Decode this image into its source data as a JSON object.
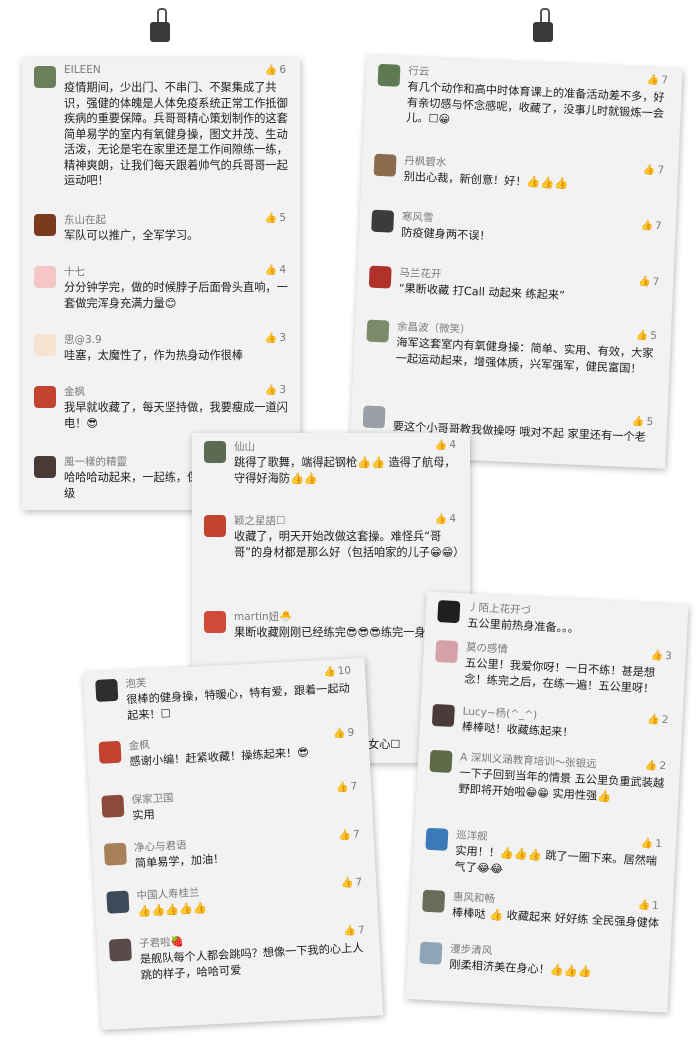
{
  "cards": [
    {
      "comments": [
        {
          "name": "EILEEN",
          "likes": "6",
          "text": "疫情期间，少出门、不串门、不聚集成了共识，强健的体魄是人体免疫系统正常工作抵御疾病的重要保障。兵哥哥精心策划制作的这套简单易学的室内有氧健身操，图文并茂、生动活泼，无论是宅在家里还是工作间隙练一练，精神爽朗，让我们每天跟着帅气的兵哥哥一起运动吧！",
          "color": "#6b7f5a"
        },
        {
          "name": "东山在起",
          "likes": "5",
          "text": "军队可以推广，全军学习。",
          "color": "#7a3a1e"
        },
        {
          "name": "十七",
          "likes": "4",
          "text": "分分钟学完，做的时候脖子后面骨头直响，一套做完浑身充满力量😊",
          "color": "#f4c6c6"
        },
        {
          "name": "思@3.9",
          "likes": "3",
          "text": "哇塞，太魔性了，作为热身动作很棒",
          "color": "#f7e3d2"
        },
        {
          "name": "金枫",
          "likes": "3",
          "text": "我早就收藏了，每天坚持做，我要瘦成一道闪电！😎",
          "color": "#c2442f"
        },
        {
          "name": "風一樣的精靈",
          "likes": "",
          "text": "哈哈哈动起来，一起练，保家卫国！封面图超级",
          "color": "#4a3a36"
        }
      ]
    },
    {
      "comments": [
        {
          "name": "行云",
          "likes": "7",
          "text": "有几个动作和高中时体育课上的准备活动差不多，好有亲切感与怀念感呢，收藏了，没事儿时就锻炼一会儿。☐😀",
          "color": "#5e7a52"
        },
        {
          "name": "丹枫碧水",
          "likes": "7",
          "text": "别出心裁，新创意！好！👍👍👍",
          "color": "#8b6a4e"
        },
        {
          "name": "寒风雪",
          "likes": "7",
          "text": "防疫健身两不误！",
          "color": "#3b3b3b"
        },
        {
          "name": "马兰花开",
          "likes": "7",
          "text": "“果断收藏 打Call 动起来 练起来”",
          "color": "#b0322a"
        },
        {
          "name": "余昌波（微笑）",
          "likes": "5",
          "text": "海军这套室内有氧健身操：简单、实用、有效，大家一起运动起来，增强体质，兴军强军，健民富国！",
          "color": "#7d8a6a"
        },
        {
          "name": "",
          "likes": "5",
          "text": "要这个小哥哥教我做操呀 哦对不起 家里还有一个老哥哥",
          "color": "#9aa0a6"
        }
      ]
    },
    {
      "comments": [
        {
          "name": "仙山",
          "likes": "4",
          "text": "跳得了歌舞，端得起钢枪👍👍 造得了航母，守得好海防👍👍",
          "color": "#5b6b52"
        },
        {
          "name": "颖之星語☐",
          "likes": "4",
          "text": "收藏了，明天开始改做这套操。难怪兵“哥哥”的身材都是那么好（包括咱家的儿子😁😁）",
          "color": "#c2442f"
        },
        {
          "name": "martin妞🐣",
          "likes": "4",
          "text": "果断收藏刚刚已经练完😎😎😎练完一身轻",
          "color": "#d04a3a"
        },
        {
          "name": "",
          "likes": "",
          "text": "女心☐",
          "color": "#d6d6d6"
        }
      ]
    },
    {
      "comments": [
        {
          "name": "泡芙",
          "likes": "10",
          "text": "很棒的健身操，特暖心，特有爱，跟着一起动起来！☐",
          "color": "#2d2d2d"
        },
        {
          "name": "金枫",
          "likes": "9",
          "text": "感谢小编！赶紧收藏！操练起来！😎",
          "color": "#c2442f"
        },
        {
          "name": "保家卫国",
          "likes": "7",
          "text": "实用",
          "color": "#8b4a3a"
        },
        {
          "name": "净心与君语",
          "likes": "7",
          "text": "简单易学，加油！",
          "color": "#a8815a"
        },
        {
          "name": "中国人寿桂兰",
          "likes": "7",
          "text": "👍👍👍👍👍",
          "color": "#3c4a5a"
        },
        {
          "name": "子君啦🍓",
          "likes": "7",
          "text": "是舰队每个人都会跳吗？想像一下我的心上人跳的样子，哈哈可爱",
          "color": "#5a4a4a"
        }
      ]
    },
    {
      "comments": [
        {
          "name": "丿陌上花开づ",
          "likes": "",
          "text": "五公里前热身准备。。。",
          "color": "#1f1f1f"
        },
        {
          "name": "莫の感情",
          "likes": "3",
          "text": "五公里！我爱你呀！一日不练！甚是想念！练完之后，在练一遍！五公里呀！",
          "color": "#d6a0a8"
        },
        {
          "name": "Lucy~杨(^_^)",
          "likes": "2",
          "text": "棒棒哒！收藏练起来！",
          "color": "#4a3a3a"
        },
        {
          "name": "A 深圳义涵教育培训～张银远",
          "likes": "2",
          "text": "一下子回到当年的情景 五公里负重武装越野即将开始啦😁😁 实用性强👍",
          "color": "#5e6a48"
        },
        {
          "name": "巡洋舰",
          "likes": "1",
          "text": "实用！！👍👍👍 跳了一圈下来。居然喘气了😂😂",
          "color": "#3a7ab8"
        },
        {
          "name": "惠风和畅",
          "likes": "1",
          "text": "棒棒哒 👍 收藏起来 好好练 全民强身健体",
          "color": "#6b6b5a"
        },
        {
          "name": "漫步清风",
          "likes": "",
          "text": "刚柔相济美在身心！👍👍👍",
          "color": "#8fa5b8"
        }
      ]
    }
  ]
}
